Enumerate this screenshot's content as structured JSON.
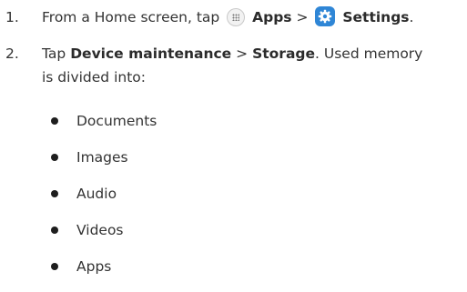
{
  "steps": [
    {
      "number": "1.",
      "prefix": "From a Home screen, tap",
      "apps_label": "Apps",
      "separator": ">",
      "settings_label": "Settings",
      "suffix": ".",
      "apps_icon": "apps-grid-icon",
      "settings_icon": "gear-icon",
      "settings_icon_color": "#2f86d6"
    },
    {
      "number": "2.",
      "prefix": "Tap",
      "menu_label": "Device maintenance",
      "separator": ">",
      "storage_label": "Storage",
      "suffix": ". Used memory",
      "line2": "is divided into:"
    }
  ],
  "categories": [
    "Documents",
    "Images",
    "Audio",
    "Videos",
    "Apps"
  ]
}
